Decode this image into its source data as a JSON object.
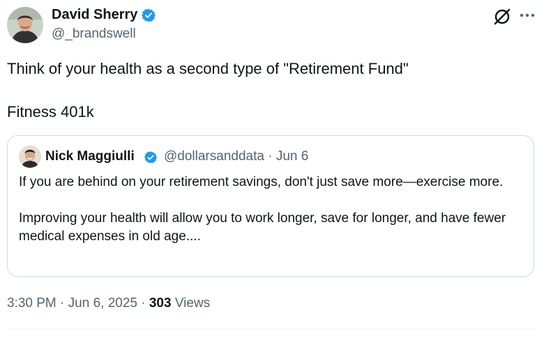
{
  "author": {
    "name": "David Sherry",
    "handle": "@_brandswell",
    "verified": true
  },
  "tweet": {
    "lines": [
      "Think of your health as a second type of \"Retirement Fund\"",
      "Fitness 401k"
    ]
  },
  "quote": {
    "author_name": "Nick Maggiulli",
    "handle": "@dollarsanddata",
    "separator": "·",
    "date": "Jun 6",
    "paragraphs": [
      "If you are behind on your retirement savings, don't just save more—exercise more.",
      "Improving your health will allow you to work longer, save for longer, and have fewer medical expenses in old age...."
    ]
  },
  "footer": {
    "time": "3:30 PM",
    "separator": "·",
    "date": "Jun 6, 2025",
    "views_count": "303",
    "views_label": "Views"
  },
  "colors": {
    "verified": "#1d9bf0",
    "secondary_text": "#536471",
    "border": "#cfd9de"
  },
  "icons": [
    "verified-badge-icon",
    "grok-icon",
    "more-icon"
  ]
}
